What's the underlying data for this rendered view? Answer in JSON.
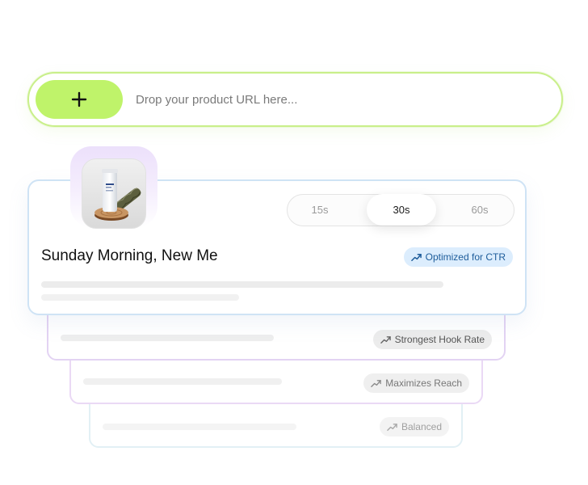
{
  "url_bar": {
    "add_icon": "plus-icon",
    "placeholder": "Drop your product URL here..."
  },
  "main_card": {
    "product_image": "product-bottle-and-incense-photo",
    "durations": [
      {
        "label": "15s",
        "selected": false
      },
      {
        "label": "30s",
        "selected": true
      },
      {
        "label": "60s",
        "selected": false
      }
    ],
    "title": "Sunday Morning, New Me",
    "badge": {
      "label": "Optimized for CTR",
      "icon": "trending-up-icon"
    }
  },
  "variants": [
    {
      "badge": "Strongest Hook Rate",
      "icon": "trending-up-icon"
    },
    {
      "badge": "Maximizes Reach",
      "icon": "trending-up-icon"
    },
    {
      "badge": "Balanced",
      "icon": "trending-up-icon"
    }
  ],
  "colors": {
    "accent_green": "#bff36a",
    "url_border": "#c9ef8a",
    "ctr_badge_bg": "#dcedfd",
    "ctr_badge_text": "#1d5c9a",
    "halo_purple": "#ece0fb"
  }
}
